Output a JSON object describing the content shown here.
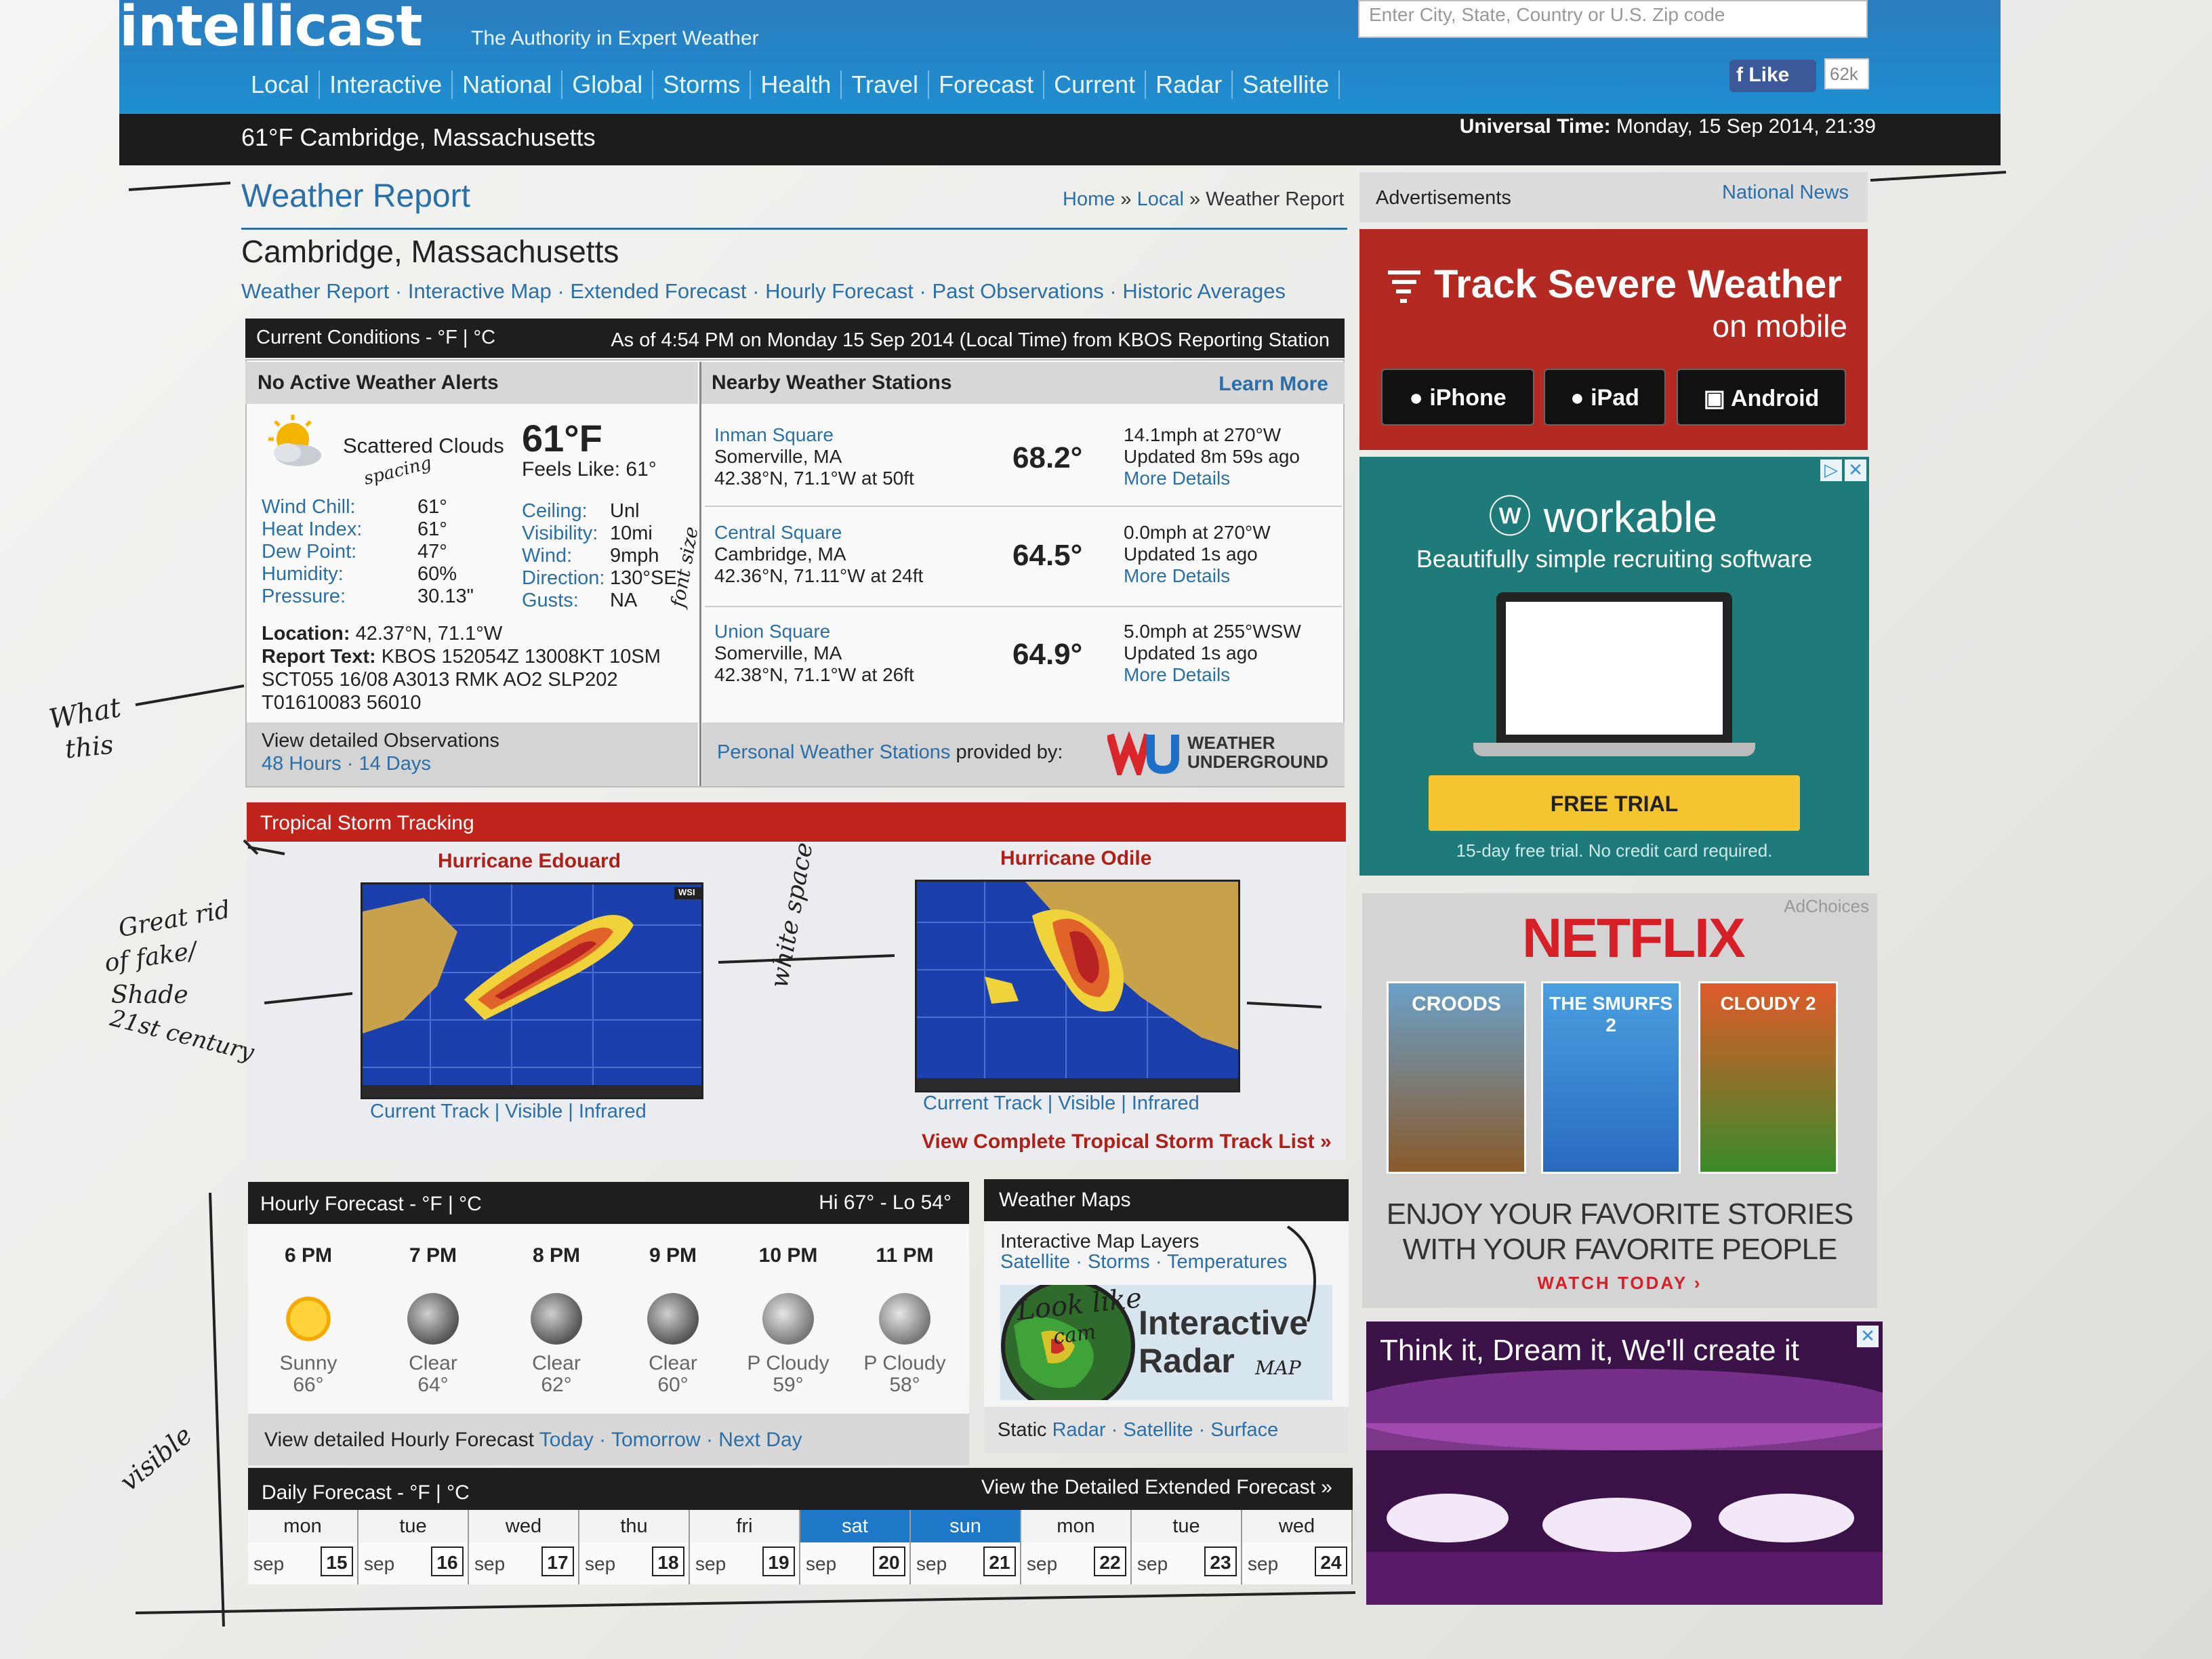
{
  "header": {
    "logo": "intellicast",
    "tagline": "The Authority in Expert Weather",
    "search_placeholder": "Enter City, State, Country or U.S. Zip code",
    "fb_like": "Like",
    "fb_count": "62k",
    "nav": [
      "Local",
      "Interactive",
      "National",
      "Global",
      "Storms",
      "Health",
      "Travel",
      "Forecast",
      "Current",
      "Radar",
      "Satellite"
    ],
    "location_temp": "61°F Cambridge, Massachusetts",
    "universal_time_label": "Universal Time:",
    "universal_time": "Monday, 15 Sep 2014, 21:39"
  },
  "page": {
    "title": "Weather Report",
    "breadcrumb": [
      "Home",
      "»",
      "Local",
      "»",
      "Weather Report"
    ],
    "city": "Cambridge, Massachusetts",
    "sublinks": [
      "Weather Report",
      "Interactive Map",
      "Extended Forecast",
      "Hourly Forecast",
      "Past Observations",
      "Historic Averages"
    ]
  },
  "current": {
    "bar_left": "Current Conditions - °F | °C",
    "bar_right": "As of 4:54 PM on Monday 15 Sep 2014 (Local Time) from KBOS Reporting Station",
    "alerts": "No Active Weather Alerts",
    "condition": "Scattered Clouds",
    "temp": "61°F",
    "feels_like": "Feels Like: 61°",
    "left_keys": [
      "Wind Chill:",
      "Heat Index:",
      "Dew Point:",
      "Humidity:",
      "Pressure:"
    ],
    "left_vals": [
      "61°",
      "61°",
      "47°",
      "60%",
      "30.13\""
    ],
    "right_keys": [
      "Ceiling:",
      "Visibility:",
      "Wind:",
      "Direction:",
      "Gusts:"
    ],
    "right_vals": [
      "Unl",
      "10mi",
      "9mph",
      "130°SE",
      "NA"
    ],
    "location_label": "Location:",
    "location": "42.37°N, 71.1°W",
    "report_label": "Report Text:",
    "report": "KBOS 152054Z 13008KT 10SM",
    "report2": "SCT055 16/08 A3013 RMK AO2 SLP202",
    "report3": "T01610083 56010",
    "obs_text": "View detailed Observations",
    "obs_links": "48 Hours · 14 Days"
  },
  "stations": {
    "header": "Nearby Weather Stations",
    "learn_more": "Learn More",
    "list": [
      {
        "name": "Inman Square",
        "city": "Somerville, MA",
        "coords": "42.38°N, 71.1°W at 50ft",
        "temp": "68.2°",
        "wind": "14.1mph at 270°W",
        "updated": "Updated 8m 59s ago",
        "more": "More Details"
      },
      {
        "name": "Central Square",
        "city": "Cambridge, MA",
        "coords": "42.36°N, 71.11°W at 24ft",
        "temp": "64.5°",
        "wind": "0.0mph at 270°W",
        "updated": "Updated 1s ago",
        "more": "More Details"
      },
      {
        "name": "Union Square",
        "city": "Somerville, MA",
        "coords": "42.38°N, 71.1°W at 26ft",
        "temp": "64.9°",
        "wind": "5.0mph at 255°WSW",
        "updated": "Updated 1s ago",
        "more": "More Details"
      }
    ],
    "pws_link": "Personal Weather Stations",
    "pws_text": "provided by:",
    "wu_name1": "WEATHER",
    "wu_name2": "UNDERGROUND"
  },
  "tropical": {
    "bar": "Tropical Storm Tracking",
    "storm1": "Hurricane Edouard",
    "storm2": "Hurricane Odile",
    "links": "Current Track | Visible | Infrared",
    "view_all": "View Complete Tropical Storm Track List »",
    "map_logo": "WSI"
  },
  "hourly": {
    "bar_left": "Hourly Forecast - °F | °C",
    "bar_right": "Hi 67° - Lo 54°",
    "hours": [
      {
        "time": "6 PM",
        "desc": "Sunny",
        "temp": "66°",
        "icon": "sun-icon"
      },
      {
        "time": "7 PM",
        "desc": "Clear",
        "temp": "64°",
        "icon": "moon-icon"
      },
      {
        "time": "8 PM",
        "desc": "Clear",
        "temp": "62°",
        "icon": "moon-icon"
      },
      {
        "time": "9 PM",
        "desc": "Clear",
        "temp": "60°",
        "icon": "moon-icon"
      },
      {
        "time": "10 PM",
        "desc": "P Cloudy",
        "temp": "59°",
        "icon": "moon-cloud-icon"
      },
      {
        "time": "11 PM",
        "desc": "P Cloudy",
        "temp": "58°",
        "icon": "moon-cloud-icon"
      }
    ],
    "foot_text": "View detailed Hourly Forecast",
    "foot_links": "Today · Tomorrow · Next Day"
  },
  "maps": {
    "bar": "Weather Maps",
    "layers_title": "Interactive Map Layers",
    "layers_links": "Satellite · Storms · Temperatures",
    "radar_line1": "Interactive",
    "radar_line2": "Radar",
    "static_label": "Static",
    "static_links": "Radar · Satellite · Surface"
  },
  "daily": {
    "bar_left": "Daily Forecast - °F | °C",
    "bar_right": "View the Detailed Extended Forecast »",
    "days": [
      "mon",
      "tue",
      "wed",
      "thu",
      "fri",
      "sat",
      "sun",
      "mon",
      "tue",
      "wed"
    ],
    "month": "sep",
    "dates": [
      "15",
      "16",
      "17",
      "18",
      "19",
      "20",
      "21",
      "22",
      "23",
      "24"
    ]
  },
  "sidebar": {
    "ads_label": "Advertisements",
    "news_link": "National News",
    "ad1_line1": "Track Severe Weather",
    "ad1_line2": "on mobile",
    "stores": [
      "iPhone",
      "iPad",
      "Android"
    ],
    "ad2_logo": "workable",
    "ad2_sub": "Beautifully simple recruiting software",
    "ad2_cta": "FREE TRIAL",
    "ad2_fine": "15-day free trial. No credit card required.",
    "ad3_brand": "NETFLIX",
    "ad3_choices": "AdChoices",
    "ad3_posters": [
      "CROODS",
      "THE SMURFS 2",
      "CLOUDY 2"
    ],
    "ad3_msg1": "ENJOY YOUR FAVORITE STORIES",
    "ad3_msg2": "WITH YOUR FAVORITE PEOPLE",
    "ad3_watch": "WATCH TODAY ›",
    "ad4_head": "Think it, Dream it, We'll create it"
  },
  "annotations": {
    "spacing": "spacing",
    "what": "What",
    "this": "this",
    "great": "Great rid",
    "of_fake": "of fake/",
    "shade": "Shade",
    "century": "21st century",
    "visible": "visible",
    "whitespace": "white space",
    "font_size": "font size",
    "look_like": "Look like",
    "map": "MAP",
    "cam": "cam"
  },
  "colors": {
    "brand_blue": "#1d90d2",
    "link": "#2a6fa8",
    "storm_red": "#c0241c",
    "netflix_red": "#d61f26",
    "workable_teal": "#1f7b7a"
  }
}
